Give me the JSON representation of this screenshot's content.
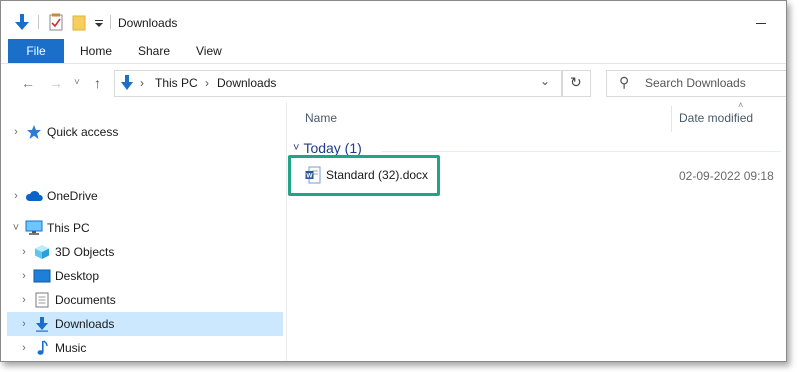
{
  "window": {
    "title": "Downloads"
  },
  "ribbon": {
    "tabs": [
      "File",
      "Home",
      "Share",
      "View"
    ]
  },
  "address": {
    "segments": [
      "This PC",
      "Downloads"
    ]
  },
  "search": {
    "placeholder": "Search Downloads"
  },
  "tree": [
    {
      "label": "Quick access",
      "icon": "star-icon"
    },
    {
      "label": "OneDrive",
      "icon": "cloud-icon"
    },
    {
      "label": "This PC",
      "icon": "computer-icon",
      "expanded": true
    },
    {
      "label": "3D Objects",
      "icon": "cube-icon"
    },
    {
      "label": "Desktop",
      "icon": "desktop-icon"
    },
    {
      "label": "Documents",
      "icon": "document-icon"
    },
    {
      "label": "Downloads",
      "icon": "download-arrow-icon",
      "selected": true
    },
    {
      "label": "Music",
      "icon": "music-note-icon"
    }
  ],
  "columns": {
    "name": "Name",
    "date": "Date modified"
  },
  "group": {
    "label": "Today (1)"
  },
  "files": [
    {
      "name": "Standard (32).docx",
      "date": "02-09-2022 09:18",
      "icon": "word-doc-icon"
    }
  ],
  "colors": {
    "accent": "#1a6fc9",
    "selection": "#cce8ff",
    "highlight": "#1ea486",
    "group_text": "#1e3b8f"
  }
}
